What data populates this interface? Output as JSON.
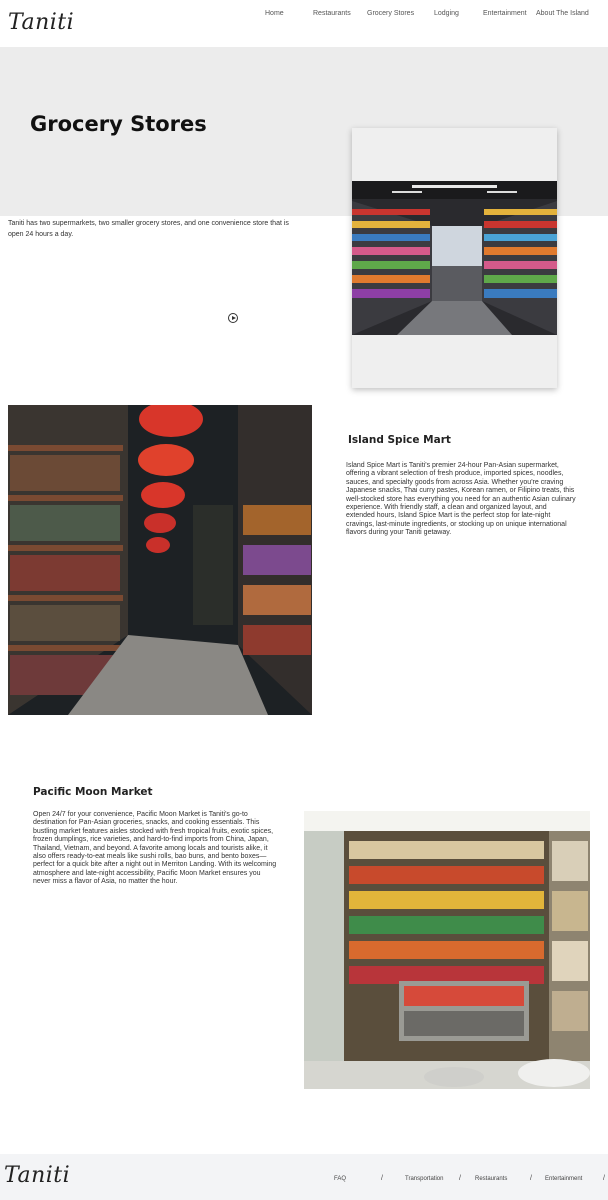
{
  "header": {
    "logo": "Taniti",
    "nav": [
      "Home",
      "Restaurants",
      "Grocery Stores",
      "Lodging",
      "Entertainment",
      "About The Island"
    ]
  },
  "hero": {
    "title": "Grocery Stores",
    "intro": "Taniti has two supermarkets, two smaller grocery stores, and one convenience store that is open 24 hours a day."
  },
  "sections": [
    {
      "title": "Island Spice Mart",
      "body": "Island Spice Mart is Taniti's premier 24-hour Pan-Asian supermarket, offering a vibrant selection of fresh produce, imported spices, noodles, sauces, and specialty goods from across Asia. Whether you're craving Japanese snacks, Thai curry pastes, Korean ramen, or Filipino treats, this well-stocked store has everything you need for an authentic Asian culinary experience. With friendly staff, a clean and organized layout, and extended hours, Island Spice Mart is the perfect stop for late-night cravings, last-minute ingredients, or stocking up on unique international flavors during your Taniti getaway."
    },
    {
      "title": "Pacific Moon Market",
      "body": "Open 24/7 for your convenience, Pacific Moon Market is Taniti's go-to destination for Pan-Asian groceries, snacks, and cooking essentials. This bustling market features aisles stocked with fresh tropical fruits, exotic spices, frozen dumplings, rice varieties, and hard-to-find imports from China, Japan, Thailand, Vietnam, and beyond. A favorite among locals and tourists alike, it also offers ready-to-eat meals like sushi rolls, bao buns, and bento boxes—perfect for a quick bite after a night out in Merriton Landing. With its welcoming atmosphere and late-night accessibility, Pacific Moon Market ensures you never miss a flavor of Asia, no matter the hour."
    }
  ],
  "footer": {
    "logo": "Taniti",
    "links": [
      "FAQ",
      "Transportation",
      "Restaurants",
      "Entertainment"
    ],
    "separator": "/"
  }
}
